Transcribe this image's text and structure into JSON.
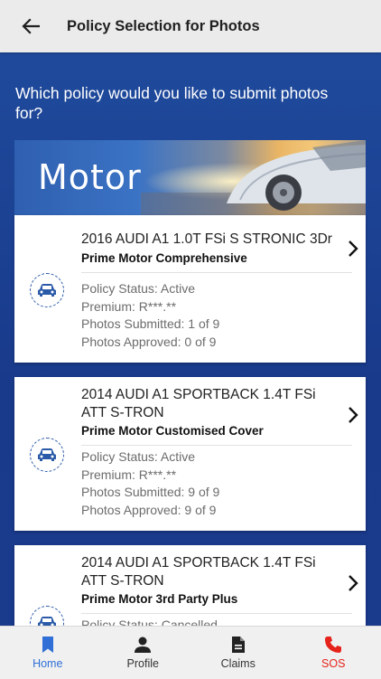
{
  "header": {
    "title": "Policy Selection for Photos"
  },
  "question": "Which policy would you like to submit photos for?",
  "banner": {
    "title": "Motor"
  },
  "policies": [
    {
      "vehicle": "2016 AUDI A1 1.0T FSi S STRONIC 3Dr",
      "plan": "Prime Motor Comprehensive",
      "status": "Policy Status: Active",
      "premium": "Premium: R***.**",
      "submitted": "Photos Submitted: 1 of 9",
      "approved": "Photos Approved: 0 of 9"
    },
    {
      "vehicle": "2014 AUDI A1 SPORTBACK 1.4T FSi ATT S-TRON",
      "plan": "Prime Motor Customised Cover",
      "status": "Policy Status: Active",
      "premium": "Premium: R***.**",
      "submitted": "Photos Submitted: 9 of 9",
      "approved": "Photos Approved: 9 of 9"
    },
    {
      "vehicle": "2014 AUDI A1 SPORTBACK 1.4T FSi ATT S-TRON",
      "plan": "Prime Motor 3rd Party Plus",
      "status": "Policy Status: Cancelled"
    }
  ],
  "nav": {
    "home": "Home",
    "profile": "Profile",
    "claims": "Claims",
    "sos": "SOS"
  },
  "colors": {
    "accent": "#2a5aa8",
    "background": "#1b3f8f",
    "sos": "#e5231b"
  }
}
